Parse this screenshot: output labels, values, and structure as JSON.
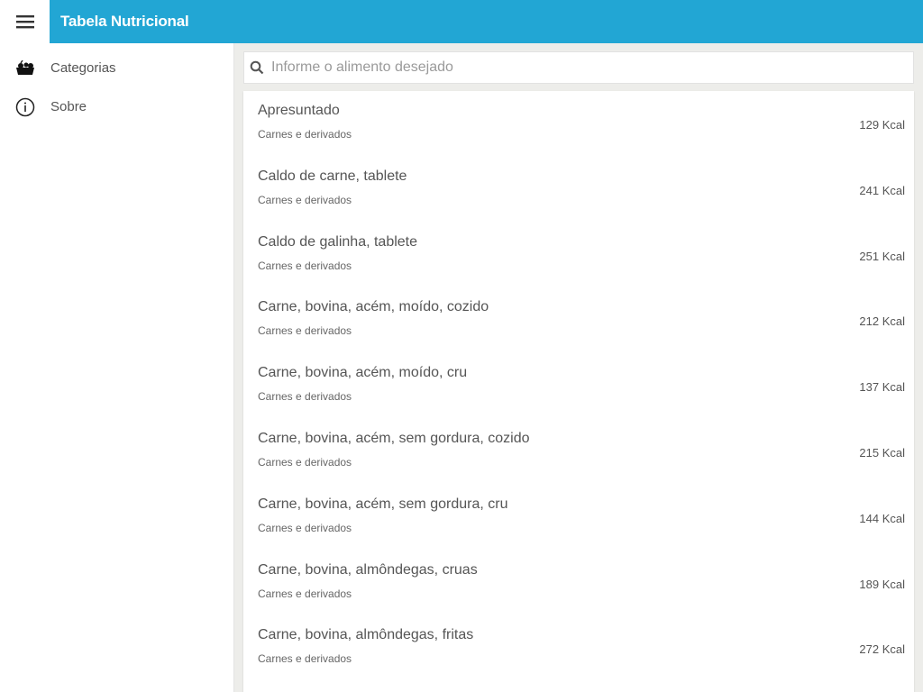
{
  "header": {
    "title": "Tabela Nutricional",
    "menu_icon": "hamburger-icon"
  },
  "sidebar": {
    "items": [
      {
        "label": "Categorias",
        "icon": "food-basket-icon"
      },
      {
        "label": "Sobre",
        "icon": "info-icon"
      }
    ]
  },
  "search": {
    "placeholder": "Informe o alimento desejado",
    "value": ""
  },
  "foods": [
    {
      "name": "Apresuntado",
      "category": "Carnes e derivados",
      "kcal": "129 Kcal"
    },
    {
      "name": "Caldo de carne, tablete",
      "category": "Carnes e derivados",
      "kcal": "241 Kcal"
    },
    {
      "name": "Caldo de galinha, tablete",
      "category": "Carnes e derivados",
      "kcal": "251 Kcal"
    },
    {
      "name": "Carne, bovina, acém, moído, cozido",
      "category": "Carnes e derivados",
      "kcal": "212 Kcal"
    },
    {
      "name": "Carne, bovina, acém, moído, cru",
      "category": "Carnes e derivados",
      "kcal": "137 Kcal"
    },
    {
      "name": "Carne, bovina, acém, sem gordura, cozido",
      "category": "Carnes e derivados",
      "kcal": "215 Kcal"
    },
    {
      "name": "Carne, bovina, acém, sem gordura, cru",
      "category": "Carnes e derivados",
      "kcal": "144 Kcal"
    },
    {
      "name": "Carne, bovina, almôndegas, cruas",
      "category": "Carnes e derivados",
      "kcal": "189 Kcal"
    },
    {
      "name": "Carne, bovina, almôndegas, fritas",
      "category": "Carnes e derivados",
      "kcal": "272 Kcal"
    }
  ]
}
